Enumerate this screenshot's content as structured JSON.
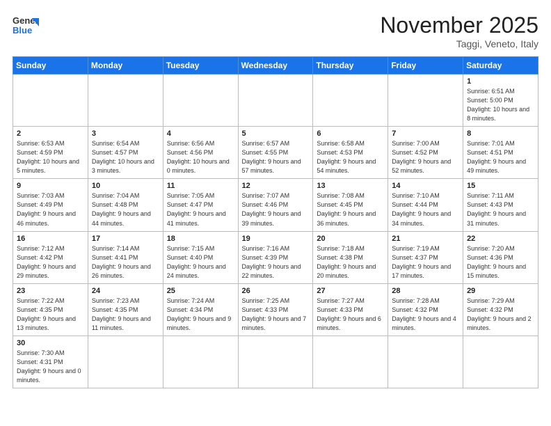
{
  "logo": {
    "text_general": "General",
    "text_blue": "Blue"
  },
  "header": {
    "month_title": "November 2025",
    "location": "Taggi, Veneto, Italy"
  },
  "weekdays": [
    "Sunday",
    "Monday",
    "Tuesday",
    "Wednesday",
    "Thursday",
    "Friday",
    "Saturday"
  ],
  "weeks": [
    [
      {
        "day": "",
        "info": ""
      },
      {
        "day": "",
        "info": ""
      },
      {
        "day": "",
        "info": ""
      },
      {
        "day": "",
        "info": ""
      },
      {
        "day": "",
        "info": ""
      },
      {
        "day": "",
        "info": ""
      },
      {
        "day": "1",
        "info": "Sunrise: 6:51 AM\nSunset: 5:00 PM\nDaylight: 10 hours and 8 minutes."
      }
    ],
    [
      {
        "day": "2",
        "info": "Sunrise: 6:53 AM\nSunset: 4:59 PM\nDaylight: 10 hours and 5 minutes."
      },
      {
        "day": "3",
        "info": "Sunrise: 6:54 AM\nSunset: 4:57 PM\nDaylight: 10 hours and 3 minutes."
      },
      {
        "day": "4",
        "info": "Sunrise: 6:56 AM\nSunset: 4:56 PM\nDaylight: 10 hours and 0 minutes."
      },
      {
        "day": "5",
        "info": "Sunrise: 6:57 AM\nSunset: 4:55 PM\nDaylight: 9 hours and 57 minutes."
      },
      {
        "day": "6",
        "info": "Sunrise: 6:58 AM\nSunset: 4:53 PM\nDaylight: 9 hours and 54 minutes."
      },
      {
        "day": "7",
        "info": "Sunrise: 7:00 AM\nSunset: 4:52 PM\nDaylight: 9 hours and 52 minutes."
      },
      {
        "day": "8",
        "info": "Sunrise: 7:01 AM\nSunset: 4:51 PM\nDaylight: 9 hours and 49 minutes."
      }
    ],
    [
      {
        "day": "9",
        "info": "Sunrise: 7:03 AM\nSunset: 4:49 PM\nDaylight: 9 hours and 46 minutes."
      },
      {
        "day": "10",
        "info": "Sunrise: 7:04 AM\nSunset: 4:48 PM\nDaylight: 9 hours and 44 minutes."
      },
      {
        "day": "11",
        "info": "Sunrise: 7:05 AM\nSunset: 4:47 PM\nDaylight: 9 hours and 41 minutes."
      },
      {
        "day": "12",
        "info": "Sunrise: 7:07 AM\nSunset: 4:46 PM\nDaylight: 9 hours and 39 minutes."
      },
      {
        "day": "13",
        "info": "Sunrise: 7:08 AM\nSunset: 4:45 PM\nDaylight: 9 hours and 36 minutes."
      },
      {
        "day": "14",
        "info": "Sunrise: 7:10 AM\nSunset: 4:44 PM\nDaylight: 9 hours and 34 minutes."
      },
      {
        "day": "15",
        "info": "Sunrise: 7:11 AM\nSunset: 4:43 PM\nDaylight: 9 hours and 31 minutes."
      }
    ],
    [
      {
        "day": "16",
        "info": "Sunrise: 7:12 AM\nSunset: 4:42 PM\nDaylight: 9 hours and 29 minutes."
      },
      {
        "day": "17",
        "info": "Sunrise: 7:14 AM\nSunset: 4:41 PM\nDaylight: 9 hours and 26 minutes."
      },
      {
        "day": "18",
        "info": "Sunrise: 7:15 AM\nSunset: 4:40 PM\nDaylight: 9 hours and 24 minutes."
      },
      {
        "day": "19",
        "info": "Sunrise: 7:16 AM\nSunset: 4:39 PM\nDaylight: 9 hours and 22 minutes."
      },
      {
        "day": "20",
        "info": "Sunrise: 7:18 AM\nSunset: 4:38 PM\nDaylight: 9 hours and 20 minutes."
      },
      {
        "day": "21",
        "info": "Sunrise: 7:19 AM\nSunset: 4:37 PM\nDaylight: 9 hours and 17 minutes."
      },
      {
        "day": "22",
        "info": "Sunrise: 7:20 AM\nSunset: 4:36 PM\nDaylight: 9 hours and 15 minutes."
      }
    ],
    [
      {
        "day": "23",
        "info": "Sunrise: 7:22 AM\nSunset: 4:35 PM\nDaylight: 9 hours and 13 minutes."
      },
      {
        "day": "24",
        "info": "Sunrise: 7:23 AM\nSunset: 4:35 PM\nDaylight: 9 hours and 11 minutes."
      },
      {
        "day": "25",
        "info": "Sunrise: 7:24 AM\nSunset: 4:34 PM\nDaylight: 9 hours and 9 minutes."
      },
      {
        "day": "26",
        "info": "Sunrise: 7:25 AM\nSunset: 4:33 PM\nDaylight: 9 hours and 7 minutes."
      },
      {
        "day": "27",
        "info": "Sunrise: 7:27 AM\nSunset: 4:33 PM\nDaylight: 9 hours and 6 minutes."
      },
      {
        "day": "28",
        "info": "Sunrise: 7:28 AM\nSunset: 4:32 PM\nDaylight: 9 hours and 4 minutes."
      },
      {
        "day": "29",
        "info": "Sunrise: 7:29 AM\nSunset: 4:32 PM\nDaylight: 9 hours and 2 minutes."
      }
    ],
    [
      {
        "day": "30",
        "info": "Sunrise: 7:30 AM\nSunset: 4:31 PM\nDaylight: 9 hours and 0 minutes."
      },
      {
        "day": "",
        "info": ""
      },
      {
        "day": "",
        "info": ""
      },
      {
        "day": "",
        "info": ""
      },
      {
        "day": "",
        "info": ""
      },
      {
        "day": "",
        "info": ""
      },
      {
        "day": "",
        "info": ""
      }
    ]
  ]
}
